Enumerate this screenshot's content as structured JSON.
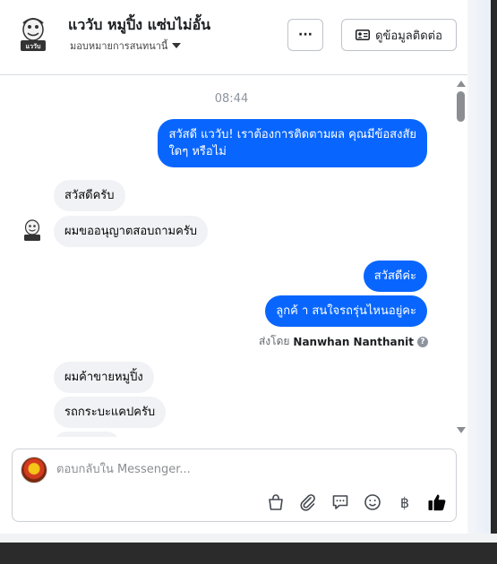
{
  "header": {
    "page_name": "แววับ หมูปิ้ง แซ่บไม่อั้น",
    "logo_text": "แววับ",
    "assign_label": "มอบหมายการสนทนานี้",
    "more_label": "···",
    "contact_label": "ดูข้อมูลติดต่อ"
  },
  "thread": {
    "timestamp": "08:44",
    "messages": [
      {
        "dir": "out",
        "line1": "สวัสดี แววับ! เราต้องการติดตามผล คุณมีข้อสงสัย",
        "line2": "ใดๆ หรือไม่"
      },
      {
        "dir": "in",
        "text": "สวัสดีครับ"
      },
      {
        "dir": "in",
        "text": "ผมขออนุญาตสอบถามครับ"
      },
      {
        "dir": "out",
        "text": "สวัสดีค่ะ"
      },
      {
        "dir": "out",
        "text": "ลูกค้ า สนใจรถรุ่นไหนอยู่คะ"
      },
      {
        "dir": "in",
        "text": "ผมค้าขายหมูปิ้ง"
      },
      {
        "dir": "in",
        "text": "รถกระบะแคปครับ"
      }
    ],
    "sent_by_prefix": "ส่งโดย",
    "sent_by_name": "Nanwhan Nanthanit"
  },
  "composer": {
    "placeholder": "ตอบกลับใน Messenger..."
  },
  "icons": [
    "chevron-down-icon",
    "more-icon",
    "contact-card-icon",
    "info-icon",
    "shopping-bag-icon",
    "paperclip-icon",
    "saved-reply-icon",
    "emoji-icon",
    "baht-icon",
    "like-icon"
  ],
  "colors": {
    "accent": "#0866ff",
    "incoming_bubble": "#f0f2f5"
  }
}
